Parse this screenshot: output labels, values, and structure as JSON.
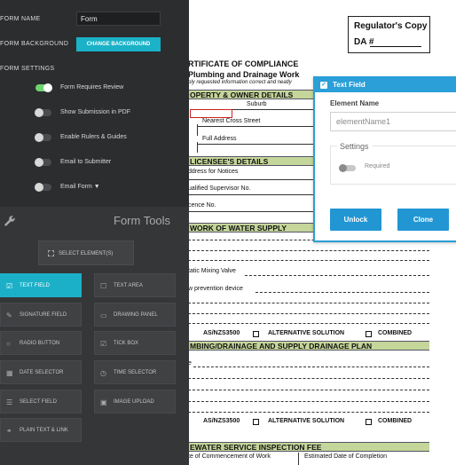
{
  "document": {
    "regulator_copy": "Regulator's Copy",
    "da_label": "DA #",
    "title_line1": "RTIFICATE OF COMPLIANCE",
    "title_line2": "Plumbing and Drainage Work",
    "title_line3": "ply requested information correct and neatly",
    "section_property": "OPERTY & OWNER DETAILS",
    "suburb": "Suburb",
    "nearest_cross_street": "Nearest Cross Street",
    "full_address": "Full Address",
    "section_licensee": "LICENSEE'S DETAILS",
    "address_notices": "ddress for Notices",
    "qualified_supervisor": "ualified Supervisor No.",
    "licence_no": "cence No.",
    "section_water": "WORK OF WATER SUPPLY",
    "thermostatic": "tatic Mixing Valve",
    "backflow": "w prevention device",
    "std_line_a": "AS/NZS3500",
    "std_line_b": "ALTERNATIVE SOLUTION",
    "std_line_c": "COMBINED",
    "section_drainage": "MBING/DRAINAGE AND SUPPLY DRAINAGE PLAN",
    "drain_line": "e",
    "section_fee": "EWATER SERVICE INSPECTION FEE",
    "commencement": "te of Commencement of Work",
    "completion": "Estimated Date of Completion"
  },
  "settings": {
    "form_name_label": "FORM NAME",
    "form_name_value": "Form",
    "form_background_label": "FORM BACKGROUND",
    "change_background_button": "CHANGE BACKGROUND",
    "form_settings_label": "FORM SETTINGS",
    "toggles": [
      {
        "label": "Form Requires Review",
        "on": true
      },
      {
        "label": "Show Submission in PDF",
        "on": false
      },
      {
        "label": "Enable Rulers & Guides",
        "on": false
      },
      {
        "label": "Email to Submitter",
        "on": false
      },
      {
        "label": "Email Form ▼",
        "on": false
      }
    ]
  },
  "tools": {
    "title": "Form Tools",
    "select_elements": "SELECT ELEMENT(S)",
    "buttons": [
      {
        "label": "TEXT FIELD",
        "icon": "text-field-icon",
        "glyph": "☑",
        "active": true
      },
      {
        "label": "TEXT AREA",
        "icon": "text-area-icon",
        "glyph": "☐",
        "active": false
      },
      {
        "label": "SIGNATURE FIELD",
        "icon": "signature-icon",
        "glyph": "✎",
        "active": false
      },
      {
        "label": "DRAWING PANEL",
        "icon": "drawing-panel-icon",
        "glyph": "▭",
        "active": false
      },
      {
        "label": "RADIO BUTTON",
        "icon": "radio-button-icon",
        "glyph": "○",
        "active": false
      },
      {
        "label": "TICK BOX",
        "icon": "tick-box-icon",
        "glyph": "☑",
        "active": false
      },
      {
        "label": "DATE SELECTOR",
        "icon": "date-selector-icon",
        "glyph": "▦",
        "active": false
      },
      {
        "label": "TIME SELECTOR",
        "icon": "time-selector-icon",
        "glyph": "◷",
        "active": false
      },
      {
        "label": "SELECT FIELD",
        "icon": "select-field-icon",
        "glyph": "☰",
        "active": false
      },
      {
        "label": "IMAGE UPLOAD",
        "icon": "image-upload-icon",
        "glyph": "▣",
        "active": false
      },
      {
        "label": "PLAIN TEXT & LINK",
        "icon": "plain-text-icon",
        "glyph": "⚭",
        "active": false
      }
    ]
  },
  "popup": {
    "title": "Text Field",
    "element_name_label": "Element Name",
    "element_name_placeholder": "elementName1",
    "settings_label": "Settings",
    "required_label": "Required",
    "unlock_button": "Unlock",
    "clone_button": "Clone"
  },
  "colors": {
    "accent": "#1cb0c8",
    "popup_blue": "#2a9fd8",
    "section_green": "#c5d69a",
    "toggle_on": "#6fd36f"
  }
}
